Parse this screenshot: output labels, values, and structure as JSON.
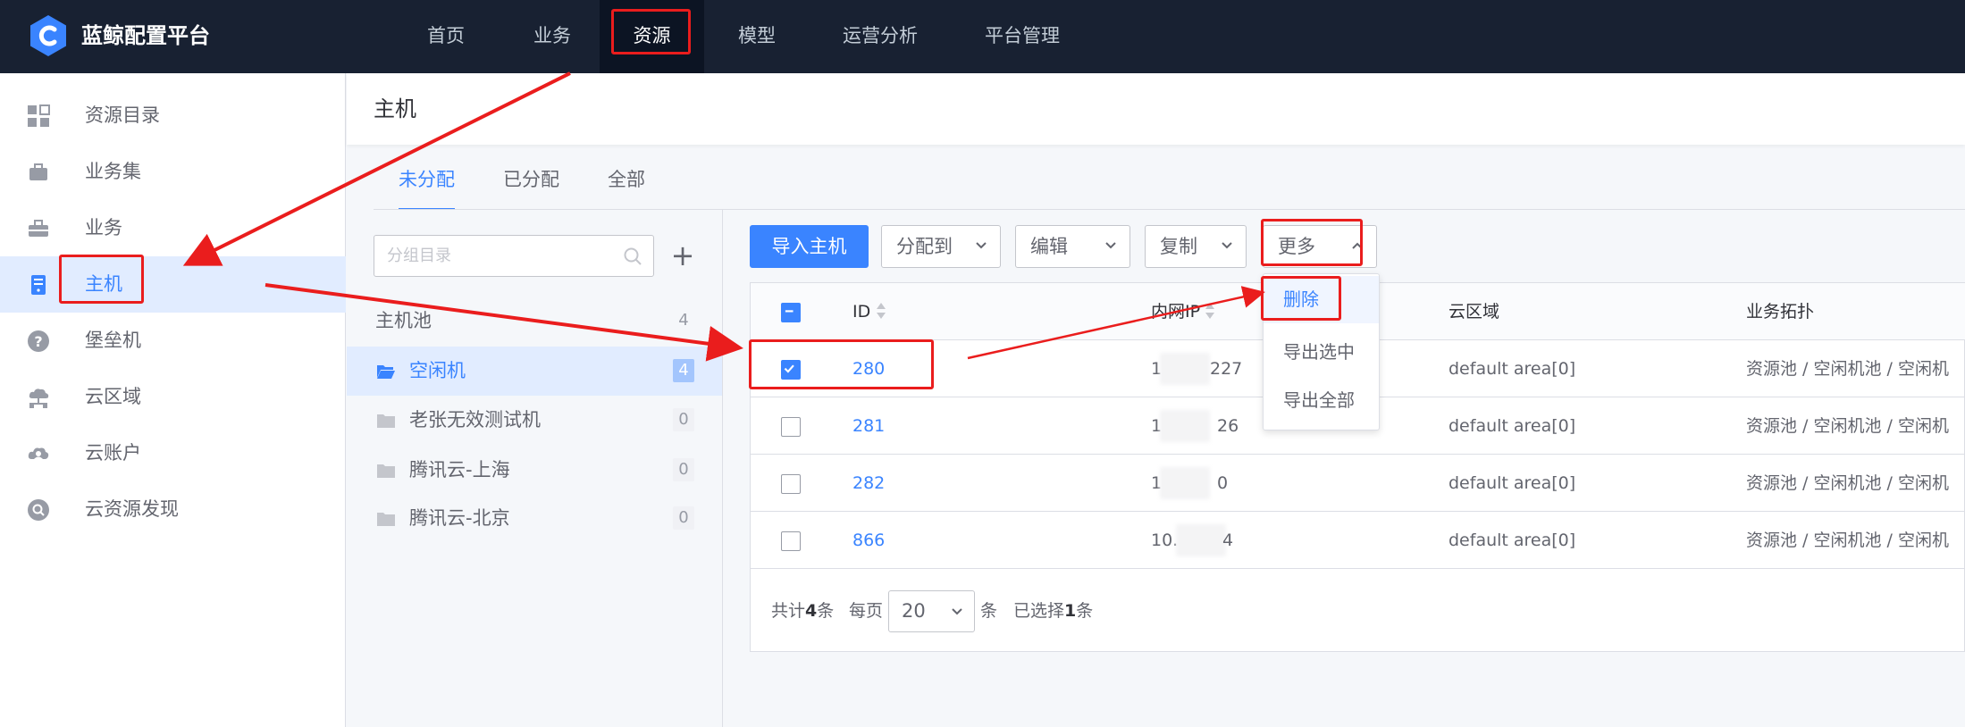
{
  "app": {
    "title": "蓝鲸配置平台"
  },
  "nav": [
    "首页",
    "业务",
    "资源",
    "模型",
    "运营分析",
    "平台管理"
  ],
  "sidebar": {
    "items": [
      {
        "label": "资源目录",
        "icon": "grid-icon"
      },
      {
        "label": "业务集",
        "icon": "briefcase-icon"
      },
      {
        "label": "业务",
        "icon": "toolbox-icon"
      },
      {
        "label": "主机",
        "icon": "host-icon"
      },
      {
        "label": "堡垒机",
        "icon": "question-icon"
      },
      {
        "label": "云区域",
        "icon": "cloud-network-icon"
      },
      {
        "label": "云账户",
        "icon": "cloud-account-icon"
      },
      {
        "label": "云资源发现",
        "icon": "discover-icon"
      }
    ]
  },
  "page": {
    "title": "主机"
  },
  "tabs": [
    "未分配",
    "已分配",
    "全部"
  ],
  "groups": {
    "search_placeholder": "分组目录",
    "add": "+",
    "items": [
      {
        "name": "主机池",
        "count": "4"
      },
      {
        "name": "空闲机",
        "count": "4"
      },
      {
        "name": "老张无效测试机",
        "count": "0"
      },
      {
        "name": "腾讯云-上海",
        "count": "0"
      },
      {
        "name": "腾讯云-北京",
        "count": "0"
      }
    ]
  },
  "toolbar": {
    "import": "导入主机",
    "assign": "分配到",
    "edit": "编辑",
    "copy": "复制",
    "more": "更多"
  },
  "more_menu": [
    "删除",
    "导出选中",
    "导出全部"
  ],
  "table": {
    "headers": {
      "id": "ID",
      "ip": "内网IP",
      "cloud": "云区域",
      "topo": "业务拓扑"
    },
    "rows": [
      {
        "id": "280",
        "ip_a": "1",
        "ip_b": "227",
        "cloud": "default area[0]",
        "topo": "资源池 / 空闲机池 / 空闲机",
        "checked": true
      },
      {
        "id": "281",
        "ip_a": "1",
        "ip_b": "26",
        "cloud": "default area[0]",
        "topo": "资源池 / 空闲机池 / 空闲机",
        "checked": false
      },
      {
        "id": "282",
        "ip_a": "1",
        "ip_b": "0",
        "cloud": "default area[0]",
        "topo": "资源池 / 空闲机池 / 空闲机",
        "checked": false
      },
      {
        "id": "866",
        "ip_a": "10.",
        "ip_b": "4",
        "cloud": "default area[0]",
        "topo": "资源池 / 空闲机池 / 空闲机",
        "checked": false
      }
    ]
  },
  "pager": {
    "total_prefix": "共计",
    "total": "4",
    "total_suffix": "条",
    "per_page_label": "每页",
    "per_page": "20",
    "per_page_suffix": "条",
    "selected_prefix": "已选择",
    "selected": "1",
    "selected_suffix": "条"
  },
  "colors": {
    "topbar": "#182132",
    "accent": "#3a84ff",
    "annotation": "#ea1d1d"
  }
}
